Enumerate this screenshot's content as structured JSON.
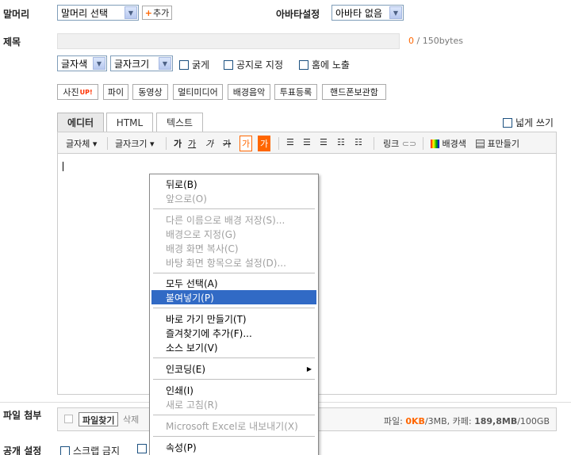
{
  "header": {
    "prefix_label": "말머리",
    "prefix_select": "말머리 선택",
    "add_button": "추가",
    "avatar_label": "아바타설정",
    "avatar_select": "아바타 없음"
  },
  "title": {
    "label": "제목",
    "counter_current": "0",
    "counter_rest": " / 150bytes"
  },
  "format": {
    "font_color": "글자색",
    "font_size": "글자크기",
    "bold": "굵게",
    "notice": "공지로 지정",
    "home": "홈에 노출"
  },
  "insert_buttons": {
    "photo": "사진",
    "photo_badge": "UP!",
    "pie": "파이",
    "video": "동영상",
    "multimedia": "멀티미디어",
    "bgm": "배경음악",
    "poll": "투표등록",
    "phone": "핸드폰보관함"
  },
  "editor_tabs": [
    "에디터",
    "HTML",
    "텍스트"
  ],
  "wide_write": "넓게 쓰기",
  "toolbar": {
    "font_face": "글자체",
    "font_size": "글자크기",
    "g1": "가",
    "g2": "가",
    "g3": "가",
    "g4": "가",
    "g5": "가",
    "g6": "가",
    "link": "링크",
    "bg_color": "배경색",
    "table": "표만들기"
  },
  "context_menu": {
    "back": "뒤로(B)",
    "forward": "앞으로(O)",
    "save_bg": "다른 이름으로 배경 저장(S)...",
    "set_bg": "배경으로 지정(G)",
    "copy_bg": "배경 화면 복사(C)",
    "desktop": "바탕 화면 항목으로 설정(D)...",
    "select_all": "모두 선택(A)",
    "paste": "붙여넣기(P)",
    "shortcut": "바로 가기 만들기(T)",
    "favorites": "즐겨찾기에 추가(F)...",
    "view_source": "소스 보기(V)",
    "encoding": "인코딩(E)",
    "print": "인쇄(I)",
    "refresh": "새로 고침(R)",
    "excel": "Microsoft Excel로 내보내기(X)",
    "properties": "속성(P)"
  },
  "attach": {
    "label": "파일 첨부",
    "find": "파일찾기",
    "delete": "삭제",
    "file_prefix": "파일: ",
    "file_used": "0KB",
    "file_rest": "/3MB, 카페: ",
    "cafe_used": "189,8MB",
    "cafe_rest": "/100GB"
  },
  "publish": {
    "label": "공개 설정",
    "scrap": "스크랩 금지"
  },
  "colors": {
    "accent": "#ff6600",
    "menu_highlight": "#316ac5"
  }
}
